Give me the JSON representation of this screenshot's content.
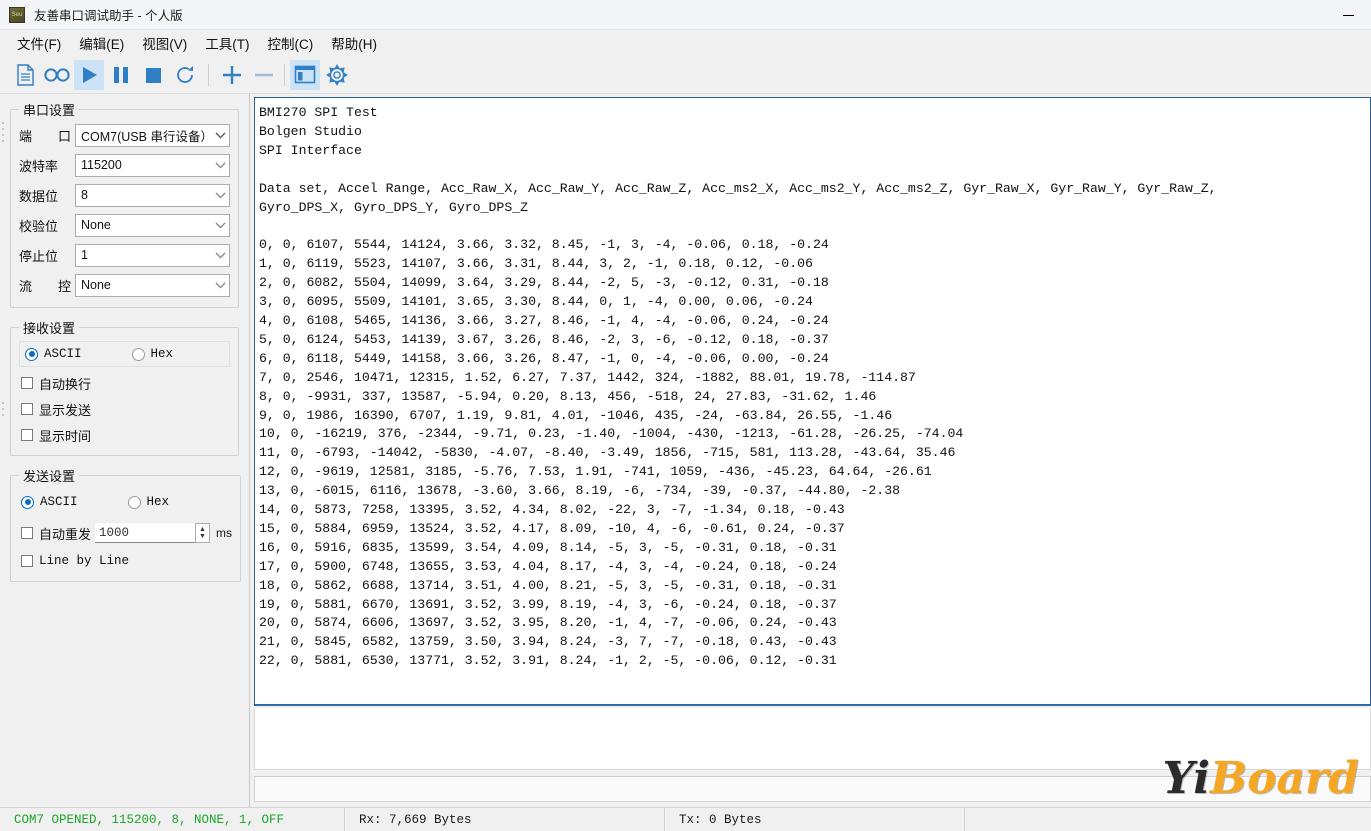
{
  "window": {
    "title": "友善串口调试助手 - 个人版",
    "icon": "app-icon",
    "minimize_label": "—"
  },
  "menubar": {
    "items": [
      {
        "label": "文件(F)",
        "name": "menu-file"
      },
      {
        "label": "编辑(E)",
        "name": "menu-edit"
      },
      {
        "label": "视图(V)",
        "name": "menu-view"
      },
      {
        "label": "工具(T)",
        "name": "menu-tools"
      },
      {
        "label": "控制(C)",
        "name": "menu-control"
      },
      {
        "label": "帮助(H)",
        "name": "menu-help"
      }
    ]
  },
  "toolbar": {
    "buttons": [
      {
        "icon": "new-document-icon",
        "active": false
      },
      {
        "icon": "record-icon",
        "active": false
      },
      {
        "icon": "play-icon",
        "active": true
      },
      {
        "icon": "pause-icon",
        "active": false
      },
      {
        "icon": "stop-icon",
        "active": false
      },
      {
        "icon": "refresh-icon",
        "active": false
      },
      {
        "icon": "plus-icon",
        "active": false
      },
      {
        "icon": "minus-icon",
        "active": false
      },
      {
        "icon": "layout-panel-icon",
        "active": true
      },
      {
        "icon": "gear-icon",
        "active": false
      }
    ],
    "accent_color": "#2f7fc4",
    "active_bg": "#cce3f7"
  },
  "sidebar": {
    "port_settings": {
      "legend": "串口设置",
      "fields": [
        {
          "label": "端　口",
          "label_left": "端",
          "label_right": "口",
          "value": "COM7(USB 串行设备）",
          "name": "port-select"
        },
        {
          "label": "波特率",
          "value": "115200",
          "name": "baudrate-select"
        },
        {
          "label": "数据位",
          "value": "8",
          "name": "databits-select"
        },
        {
          "label": "校验位",
          "value": "None",
          "name": "parity-select"
        },
        {
          "label": "停止位",
          "value": "1",
          "name": "stopbits-select"
        },
        {
          "label": "流　控",
          "label_left": "流",
          "label_right": "控",
          "value": "None",
          "name": "flowcontrol-select"
        }
      ]
    },
    "receive_settings": {
      "legend": "接收设置",
      "ascii_label": "ASCII",
      "hex_label": "Hex",
      "mode_selected": "ASCII",
      "checkboxes": [
        {
          "label": "自动换行",
          "checked": false,
          "name": "auto-wrap-checkbox"
        },
        {
          "label": "显示发送",
          "checked": false,
          "name": "show-send-checkbox"
        },
        {
          "label": "显示时间",
          "checked": false,
          "name": "show-time-checkbox"
        }
      ]
    },
    "send_settings": {
      "legend": "发送设置",
      "ascii_label": "ASCII",
      "hex_label": "Hex",
      "mode_selected": "ASCII",
      "auto_resend_label": "自动重发",
      "auto_resend_checked": false,
      "interval_value": "1000",
      "interval_unit": "ms",
      "line_by_line_label": "Line by Line",
      "line_by_line_checked": false
    }
  },
  "terminal": {
    "content": "BMI270 SPI Test\nBolgen Studio\nSPI Interface\n\nData set, Accel Range, Acc_Raw_X, Acc_Raw_Y, Acc_Raw_Z, Acc_ms2_X, Acc_ms2_Y, Acc_ms2_Z, Gyr_Raw_X, Gyr_Raw_Y, Gyr_Raw_Z,\nGyro_DPS_X, Gyro_DPS_Y, Gyro_DPS_Z\n\n0, 0, 6107, 5544, 14124, 3.66, 3.32, 8.45, -1, 3, -4, -0.06, 0.18, -0.24\n1, 0, 6119, 5523, 14107, 3.66, 3.31, 8.44, 3, 2, -1, 0.18, 0.12, -0.06\n2, 0, 6082, 5504, 14099, 3.64, 3.29, 8.44, -2, 5, -3, -0.12, 0.31, -0.18\n3, 0, 6095, 5509, 14101, 3.65, 3.30, 8.44, 0, 1, -4, 0.00, 0.06, -0.24\n4, 0, 6108, 5465, 14136, 3.66, 3.27, 8.46, -1, 4, -4, -0.06, 0.24, -0.24\n5, 0, 6124, 5453, 14139, 3.67, 3.26, 8.46, -2, 3, -6, -0.12, 0.18, -0.37\n6, 0, 6118, 5449, 14158, 3.66, 3.26, 8.47, -1, 0, -4, -0.06, 0.00, -0.24\n7, 0, 2546, 10471, 12315, 1.52, 6.27, 7.37, 1442, 324, -1882, 88.01, 19.78, -114.87\n8, 0, -9931, 337, 13587, -5.94, 0.20, 8.13, 456, -518, 24, 27.83, -31.62, 1.46\n9, 0, 1986, 16390, 6707, 1.19, 9.81, 4.01, -1046, 435, -24, -63.84, 26.55, -1.46\n10, 0, -16219, 376, -2344, -9.71, 0.23, -1.40, -1004, -430, -1213, -61.28, -26.25, -74.04\n11, 0, -6793, -14042, -5830, -4.07, -8.40, -3.49, 1856, -715, 581, 113.28, -43.64, 35.46\n12, 0, -9619, 12581, 3185, -5.76, 7.53, 1.91, -741, 1059, -436, -45.23, 64.64, -26.61\n13, 0, -6015, 6116, 13678, -3.60, 3.66, 8.19, -6, -734, -39, -0.37, -44.80, -2.38\n14, 0, 5873, 7258, 13395, 3.52, 4.34, 8.02, -22, 3, -7, -1.34, 0.18, -0.43\n15, 0, 5884, 6959, 13524, 3.52, 4.17, 8.09, -10, 4, -6, -0.61, 0.24, -0.37\n16, 0, 5916, 6835, 13599, 3.54, 4.09, 8.14, -5, 3, -5, -0.31, 0.18, -0.31\n17, 0, 5900, 6748, 13655, 3.53, 4.04, 8.17, -4, 3, -4, -0.24, 0.18, -0.24\n18, 0, 5862, 6688, 13714, 3.51, 4.00, 8.21, -5, 3, -5, -0.31, 0.18, -0.31\n19, 0, 5881, 6670, 13691, 3.52, 3.99, 8.19, -4, 3, -6, -0.24, 0.18, -0.37\n20, 0, 5874, 6606, 13697, 3.52, 3.95, 8.20, -1, 4, -7, -0.06, 0.24, -0.43\n21, 0, 5845, 6582, 13759, 3.50, 3.94, 8.24, -3, 7, -7, -0.18, 0.43, -0.43\n22, 0, 5881, 6530, 13771, 3.52, 3.91, 8.24, -1, 2, -5, -0.06, 0.12, -0.31"
  },
  "send_area": {
    "textarea_value": "",
    "input_value": ""
  },
  "watermark": {
    "text_dark": "Yi",
    "text_accent": "Board",
    "accent_color": "#f5a623"
  },
  "statusbar": {
    "connection": "COM7 OPENED, 115200, 8, NONE, 1, OFF",
    "connection_color": "#19a52a",
    "rx": "Rx: 7,669 Bytes",
    "tx": "Tx: 0 Bytes",
    "extra": ""
  }
}
